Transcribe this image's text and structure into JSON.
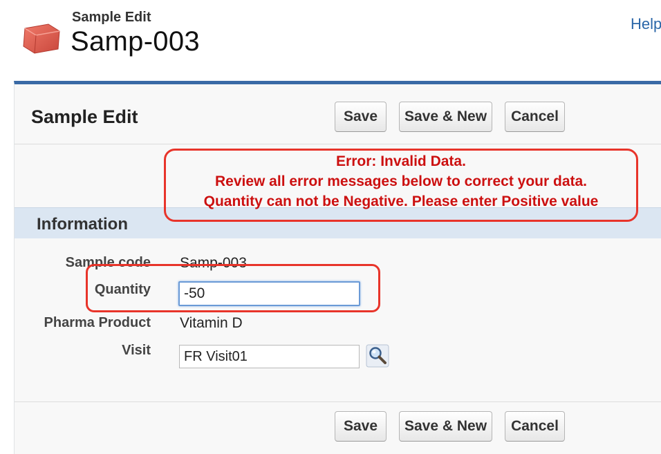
{
  "header": {
    "object_type": "Sample Edit",
    "record_name": "Samp-003",
    "help_link": "Help"
  },
  "page_block": {
    "title": "Sample Edit",
    "buttons": {
      "save": "Save",
      "save_new": "Save & New",
      "cancel": "Cancel"
    }
  },
  "error": {
    "line1": "Error: Invalid Data.",
    "line2": "Review all error messages below to correct your data.",
    "line3": "Quantity can not be Negative. Please enter Positive value"
  },
  "section": {
    "title": "Information"
  },
  "fields": {
    "sample_code": {
      "label": "Sample code",
      "value": "Samp-003"
    },
    "quantity": {
      "label": "Quantity",
      "value": "-50"
    },
    "pharma_product": {
      "label": "Pharma Product",
      "value": "Vitamin D"
    },
    "visit": {
      "label": "Visit",
      "value": "FR Visit01"
    }
  },
  "icons": {
    "object": "sample-box-icon",
    "lookup": "magnifier-lookup-icon"
  },
  "colors": {
    "accent": "#3a6aa6",
    "error": "#cc1010",
    "highlight": "#e8342a",
    "section_bg": "#dbe6f2"
  }
}
